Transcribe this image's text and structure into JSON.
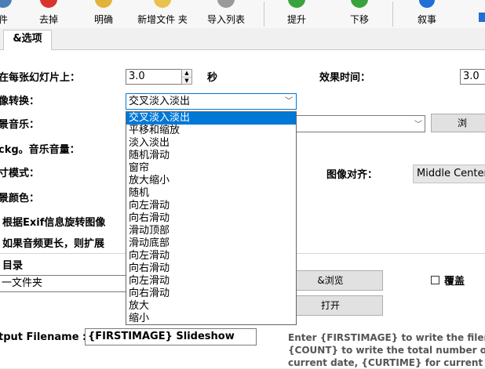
{
  "toolbar": {
    "items": [
      {
        "label": "件",
        "icon": "file-icon"
      },
      {
        "label": "去掉",
        "icon": "remove-icon"
      },
      {
        "label": "明确",
        "icon": "clear-icon"
      },
      {
        "label": "新增文件 夹",
        "icon": "add-folder-icon"
      },
      {
        "label": "导入列表",
        "icon": "import-list-icon"
      },
      {
        "label": "提升",
        "icon": "move-up-icon"
      },
      {
        "label": "下移",
        "icon": "move-down-icon"
      },
      {
        "label": "叙事",
        "icon": "narrate-icon"
      }
    ]
  },
  "tab": {
    "label": "&选项"
  },
  "form": {
    "per_slide_label": "在每张幻灯片上：",
    "per_slide_value": "3.0",
    "seconds_unit": "秒",
    "effect_time_label": "效果时间：",
    "effect_time_value": "3.0",
    "transition_label": "像转换：",
    "transition_value": "交叉淡入淡出",
    "bg_music_label": "景音乐：",
    "browse_music_label": "浏",
    "bkg_volume_label": "ckg。音乐音量：",
    "size_mode_label": "寸模式：",
    "align_label": "图像对齐：",
    "align_value": "Middle Center",
    "bg_color_label": "景颜色：",
    "exif_rotate_label": "根据Exif信息旋转图像",
    "audio_extend_label": "如果音频更长，则扩展",
    "dir_label": "目录",
    "folder_value": "一文件夹",
    "browse_label": "&浏览",
    "overwrite_label": "覆盖",
    "open_label": "打开",
    "output_filename_label": "tput Filename :",
    "output_filename_value": "{FIRSTIMAGE} Slideshow",
    "help_line1": "Enter {FIRSTIMAGE} to write the filen",
    "help_line2": "{COUNT} to write the total number of",
    "help_line3": "current date, {CURTIME} for current t"
  },
  "transition_options": [
    "交叉淡入淡出",
    "平移和缩放",
    "淡入淡出",
    "随机滑动",
    "窗帘",
    "放大缩小",
    "随机",
    "向左滑动",
    "向右滑动",
    "滑动顶部",
    "滑动底部",
    "向左滑动",
    "向右滑动",
    "向左滑动",
    "向右滑动",
    "放大",
    "缩小"
  ],
  "selected_index": 0,
  "colors": {
    "accent": "#0078d7"
  }
}
